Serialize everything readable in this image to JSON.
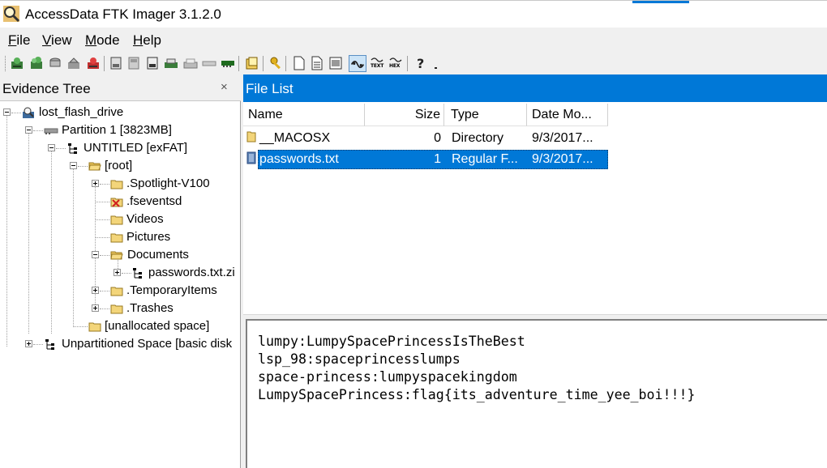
{
  "window": {
    "title": "AccessData FTK Imager 3.1.2.0",
    "accent_color": "#0078d7"
  },
  "menu": {
    "items": [
      {
        "label": "File",
        "underline": "F",
        "rest": "ile"
      },
      {
        "label": "View",
        "underline": "V",
        "rest": "iew"
      },
      {
        "label": "Mode",
        "underline": "M",
        "rest": "ode"
      },
      {
        "label": "Help",
        "underline": "H",
        "rest": "elp"
      }
    ]
  },
  "toolbar": {
    "buttons": [
      "add-evidence-icon",
      "add-all-evidence-icon",
      "image-mounting-icon",
      "remove-evidence-icon",
      "remove-all-evidence-icon",
      "create-disk-image-icon",
      "export-disk-image-icon",
      "export-logical-image-icon",
      "obtain-protected-files-icon",
      "capture-memory-icon",
      "detect-encryption-icon",
      "verify-drive-icon",
      "export-files-icon",
      "export-hash-list-icon",
      "show-file-icon",
      "auto-view-icon",
      "natural-view-icon",
      "text-view-icon",
      "hex-view-icon",
      "help-icon",
      "dropdown-icon"
    ],
    "text_label": "TEXT",
    "hex_label": "HEX",
    "active": "natural-view-icon"
  },
  "evidence_tree": {
    "title": "Evidence Tree",
    "close": "×",
    "nodes": [
      {
        "label": "lost_flash_drive",
        "icon": "evidence-icon"
      },
      {
        "label": "Partition 1 [3823MB]",
        "icon": "partition-icon"
      },
      {
        "label": "UNTITLED [exFAT]",
        "icon": "filesystem-icon"
      },
      {
        "label": "[root]",
        "icon": "folder-open-icon"
      },
      {
        "label": ".Spotlight-V100",
        "icon": "folder-icon"
      },
      {
        "label": ".fseventsd",
        "icon": "deleted-folder-icon"
      },
      {
        "label": "Videos",
        "icon": "folder-icon"
      },
      {
        "label": "Pictures",
        "icon": "folder-icon"
      },
      {
        "label": "Documents",
        "icon": "folder-open-icon"
      },
      {
        "label": "passwords.txt.zi",
        "icon": "archive-icon"
      },
      {
        "label": ".TemporaryItems",
        "icon": "folder-icon"
      },
      {
        "label": ".Trashes",
        "icon": "folder-icon"
      },
      {
        "label": "[unallocated space]",
        "icon": "folder-icon"
      },
      {
        "label": "Unpartitioned Space [basic disk",
        "icon": "unpartitioned-icon"
      }
    ]
  },
  "file_list": {
    "title": "File List",
    "columns": [
      "Name",
      "Size",
      "Type",
      "Date Mo..."
    ],
    "rows": [
      {
        "name": "__MACOSX",
        "size": "0",
        "type": "Directory",
        "date": "9/3/2017..."
      },
      {
        "name": "passwords.txt",
        "size": "1",
        "type": "Regular F...",
        "date": "9/3/2017...",
        "selected": true
      }
    ]
  },
  "viewer": {
    "lines": [
      "lumpy:LumpySpacePrincessIsTheBest",
      "lsp_98:spaceprincesslumps",
      "space-princess:lumpyspacekingdom",
      "LumpySpacePrincess:flag{its_adventure_time_yee_boi!!!}"
    ]
  }
}
